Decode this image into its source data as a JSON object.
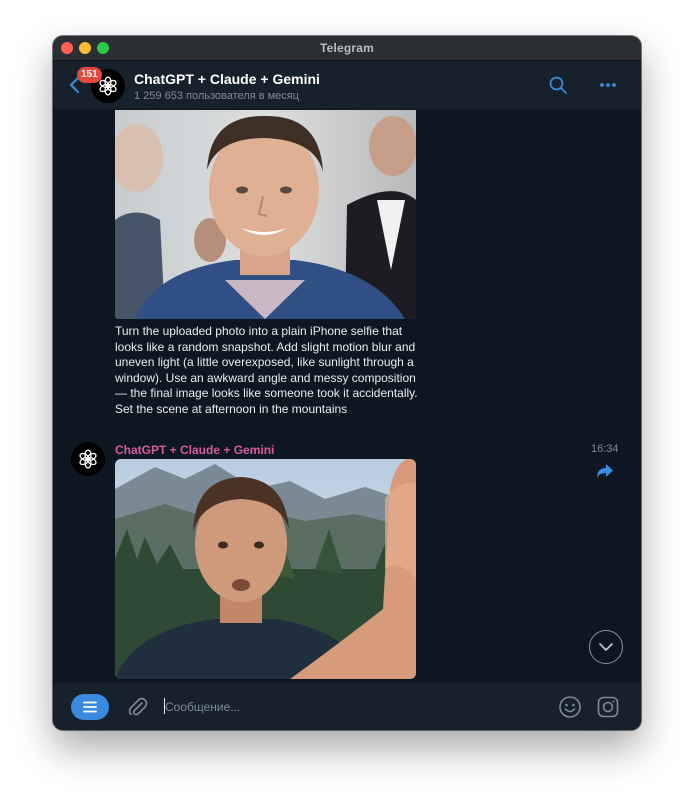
{
  "window": {
    "title": "Telegram"
  },
  "header": {
    "unread_badge": "151",
    "chat_title": "ChatGPT + Claude + Gemini",
    "subtitle": "1 259 653 пользователя в месяц",
    "back_icon": "chevron-left-icon",
    "search_icon": "search-icon",
    "more_icon": "more-horizontal-icon"
  },
  "messages": [
    {
      "type": "photo-with-caption",
      "photo_icon": "portrait-photo",
      "text": "Turn the uploaded photo into a plain iPhone selfie that looks like a random snapshot. Add slight motion blur and uneven light (a little overexposed, like sunlight through a window). Use an awkward angle and messy composition — the final image looks like someone took it accidentally. Set the scene at afternoon in the mountains"
    },
    {
      "type": "photo",
      "sender": "ChatGPT + Claude + Gemini",
      "time": "16:34",
      "photo_icon": "mountain-selfie-photo",
      "forward_icon": "forward-arrow-icon"
    }
  ],
  "composer": {
    "placeholder": "Сообщение...",
    "menu_icon": "menu-icon",
    "attach_icon": "paperclip-icon",
    "emoji_icon": "emoji-icon",
    "camera_icon": "instagram-camera-icon"
  },
  "colors": {
    "accent": "#3a8be0",
    "sender_name": "#d75c9f",
    "chat_bg": "#0e1621",
    "panel_bg": "#17212b",
    "badge": "#e5493c"
  }
}
